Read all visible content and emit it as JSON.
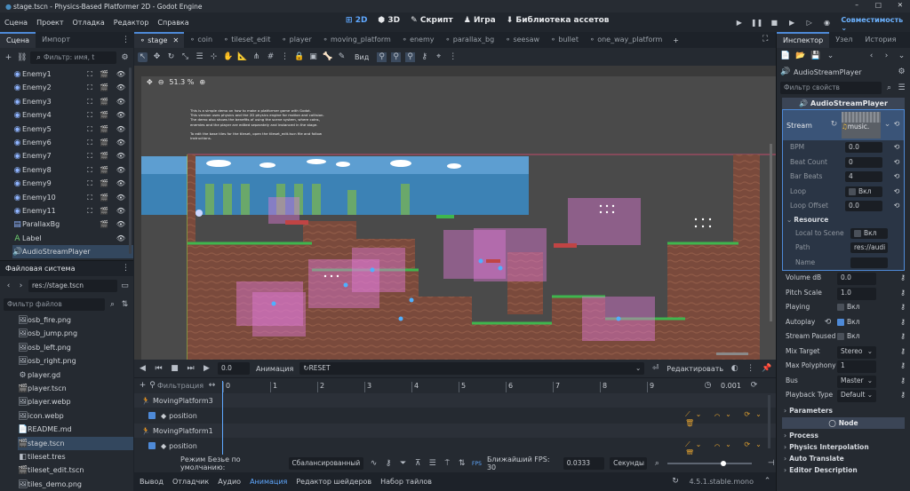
{
  "window_title": "stage.tscn - Physics-Based Platformer 2D - Godot Engine",
  "menu": [
    "Сцена",
    "Проект",
    "Отладка",
    "Редактор",
    "Справка"
  ],
  "workspaces": [
    "2D",
    "3D",
    "Скрипт",
    "Игра",
    "Библиотека ассетов"
  ],
  "renderer": "Совместимость",
  "scene_dock": {
    "tabs": [
      "Сцена",
      "Импорт"
    ],
    "filter_placeholder": "Фильтр: имя, t",
    "items": [
      "Enemy1",
      "Enemy2",
      "Enemy3",
      "Enemy4",
      "Enemy5",
      "Enemy6",
      "Enemy7",
      "Enemy8",
      "Enemy9",
      "Enemy10",
      "Enemy11",
      "ParallaxBg",
      "Label",
      "AudioStreamPlayer"
    ]
  },
  "filesystem": {
    "title": "Файловая система",
    "path": "res://stage.tscn",
    "filter_placeholder": "Фильтр файлов",
    "files": [
      "osb_fire.png",
      "osb_jump.png",
      "osb_left.png",
      "osb_right.png",
      "player.gd",
      "player.tscn",
      "player.webp",
      "icon.webp",
      "README.md",
      "stage.tscn",
      "tileset.tres",
      "tileset_edit.tscn",
      "tiles_demo.png"
    ]
  },
  "editor_tabs": [
    "stage",
    "coin",
    "tileset_edit",
    "player",
    "moving_platform",
    "enemy",
    "parallax_bg",
    "seesaw",
    "bullet",
    "one_way_platform"
  ],
  "toolbar_view": "Вид",
  "zoom": "51.3 %",
  "label_text": [
    "This is a simple demo on how to make a platformer game with Godot.",
    "This version uses physics and the 2D physics engine for motion and collision.",
    "The demo also shows the benefits of using the scene system, where coins,",
    "enemies and the player are edited separately and instanced in the stage.",
    "",
    "To edit the base tiles for the  tileset, open the tileset_edit.tscn file and follow",
    "instructions."
  ],
  "animation": {
    "time": "0.0",
    "menu_label": "Анимация",
    "anim_name": "RESET",
    "edit_btn": "Редактировать",
    "filter_label": "Фильтрация",
    "ticks": [
      "0",
      "1",
      "2",
      "3",
      "4",
      "5",
      "6",
      "7",
      "8",
      "9"
    ],
    "step": "0.001",
    "tracks": [
      {
        "node": "MovingPlatform3",
        "prop": "position"
      },
      {
        "node": "MovingPlatform1",
        "prop": "position"
      }
    ],
    "bezier_label": "Режим Безье по умолчанию:",
    "bezier_value": "Сбалансированный",
    "fps_label": "Ближайший FPS: 30",
    "snap_value": "0.0333",
    "snap_unit": "Секунды"
  },
  "bottom_tabs": [
    "Вывод",
    "Отладчик",
    "Аудио",
    "Анимация",
    "Редактор шейдеров",
    "Набор тайлов"
  ],
  "version": "4.5.1.stable.mono",
  "inspector": {
    "tabs": [
      "Инспектор",
      "Узел",
      "История"
    ],
    "node_name": "AudioStreamPlayer",
    "filter_placeholder": "Фильтр свойств",
    "category": "AudioStreamPlayer",
    "stream_label": "Stream",
    "stream_value": "music.",
    "stream_sub": [
      {
        "label": "BPM",
        "value": "0.0"
      },
      {
        "label": "Beat Count",
        "value": "0"
      },
      {
        "label": "Bar Beats",
        "value": "4"
      },
      {
        "label": "Loop",
        "value": "Вкл"
      },
      {
        "label": "Loop Offset",
        "value": "0.0"
      }
    ],
    "resource_section": "Resource",
    "resource_rows": [
      {
        "label": "Local to Scene",
        "value": "Вкл"
      },
      {
        "label": "Path",
        "value": "res://audi"
      },
      {
        "label": "Name",
        "value": ""
      }
    ],
    "props": [
      {
        "label": "Volume dB",
        "value": "0.0",
        "unit": "dB"
      },
      {
        "label": "Pitch Scale",
        "value": "1.0"
      },
      {
        "label": "Playing",
        "value": "Вкл"
      },
      {
        "label": "Autoplay",
        "value": "Вкл"
      },
      {
        "label": "Stream Paused",
        "value": "Вкл"
      },
      {
        "label": "Mix Target",
        "value": "Stereo"
      },
      {
        "label": "Max Polyphony",
        "value": "1"
      },
      {
        "label": "Bus",
        "value": "Master"
      },
      {
        "label": "Playback Type",
        "value": "Default"
      }
    ],
    "sections": [
      "Parameters",
      "Node",
      "Process",
      "Physics Interpolation",
      "Auto Translate",
      "Editor Description"
    ],
    "colors": {
      "accent": "#4e8ad8",
      "selection": "#33475e",
      "panel": "#252a31",
      "background": "#1d2229"
    }
  }
}
